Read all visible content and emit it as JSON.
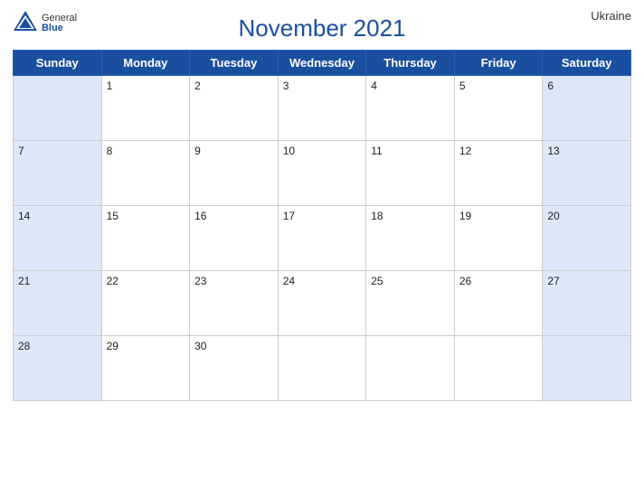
{
  "header": {
    "title": "November 2021",
    "country": "Ukraine",
    "logo_general": "General",
    "logo_blue": "Blue"
  },
  "days_of_week": [
    "Sunday",
    "Monday",
    "Tuesday",
    "Wednesday",
    "Thursday",
    "Friday",
    "Saturday"
  ],
  "weeks": [
    [
      null,
      "1",
      "2",
      "3",
      "4",
      "5",
      "6"
    ],
    [
      "7",
      "8",
      "9",
      "10",
      "11",
      "12",
      "13"
    ],
    [
      "14",
      "15",
      "16",
      "17",
      "18",
      "19",
      "20"
    ],
    [
      "21",
      "22",
      "23",
      "24",
      "25",
      "26",
      "27"
    ],
    [
      "28",
      "29",
      "30",
      null,
      null,
      null,
      null
    ]
  ],
  "colors": {
    "header_bg": "#1a4fa0",
    "weekend_bg": "#dce8f8",
    "weekday_bg": "#ffffff",
    "border": "#cccccc"
  }
}
